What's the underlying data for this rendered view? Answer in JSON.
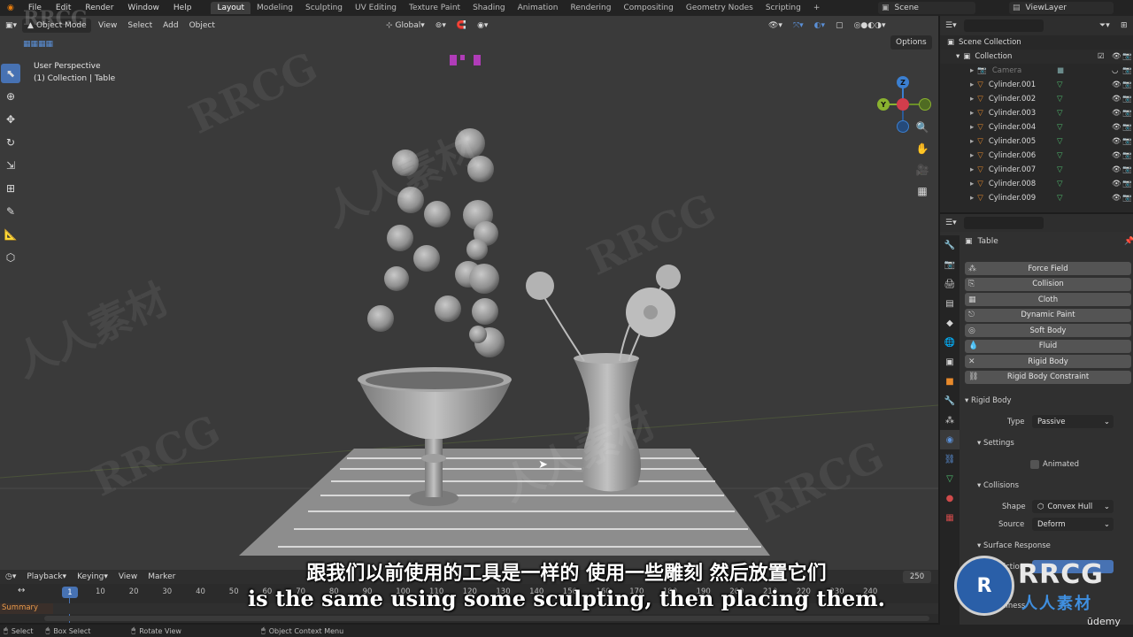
{
  "topbar": {
    "menus": [
      "File",
      "Edit",
      "Render",
      "Window",
      "Help"
    ],
    "workspaces": [
      "Layout",
      "Modeling",
      "Sculpting",
      "UV Editing",
      "Texture Paint",
      "Shading",
      "Animation",
      "Rendering",
      "Compositing",
      "Geometry Nodes",
      "Scripting"
    ],
    "active_workspace": "Layout",
    "add_workspace": "+",
    "scene": "Scene",
    "view_layer": "ViewLayer"
  },
  "viewport": {
    "mode": "Object Mode",
    "menus": [
      "View",
      "Select",
      "Add",
      "Object"
    ],
    "transform_orientation": "Global",
    "options": "Options",
    "info_line1": "User Perspective",
    "info_line2": "(1) Collection | Table",
    "gizmo": {
      "z": "Z",
      "y": "Y",
      "x": "X"
    }
  },
  "outliner": {
    "root": "Scene Collection",
    "collection": "Collection",
    "items": [
      "Camera",
      "Cylinder.001",
      "Cylinder.002",
      "Cylinder.003",
      "Cylinder.004",
      "Cylinder.005",
      "Cylinder.006",
      "Cylinder.007",
      "Cylinder.008",
      "Cylinder.009"
    ]
  },
  "properties": {
    "object_name": "Table",
    "physics_buttons": [
      "Force Field",
      "Collision",
      "Cloth",
      "Dynamic Paint",
      "Soft Body",
      "Fluid",
      "Rigid Body",
      "Rigid Body Constraint"
    ],
    "rigid_body_panel": "Rigid Body",
    "type_label": "Type",
    "type_value": "Passive",
    "settings_panel": "Settings",
    "animated_label": "Animated",
    "collisions_panel": "Collisions",
    "shape_label": "Shape",
    "shape_value": "Convex Hull",
    "source_label": "Source",
    "source_value": "Deform",
    "surface_panel": "Surface Response",
    "friction_partial": "Friction",
    "bounciness_partial": "Bounciness"
  },
  "timeline": {
    "menus": [
      "Playback",
      "Keying",
      "View",
      "Marker"
    ],
    "current_frame": "1",
    "ticks": [
      "10",
      "20",
      "30",
      "40",
      "50",
      "60",
      "70",
      "80",
      "90",
      "100",
      "110",
      "120",
      "130",
      "140",
      "150",
      "160",
      "170",
      "180",
      "190",
      "200",
      "210",
      "220",
      "230",
      "240"
    ],
    "end_frame": "250",
    "summary": "Summary"
  },
  "statusbar": {
    "select": "Select",
    "box_select": "Box Select",
    "rotate_view": "Rotate View",
    "context_menu": "Object Context Menu"
  },
  "subtitles": {
    "chinese": "跟我们以前使用的工具是一样的 使用一些雕刻 然后放置它们",
    "english": "is the same using some sculpting, then placing them."
  },
  "watermark": {
    "brand": "RRCG",
    "brand_cn": "人人素材",
    "udemy": "ūdemy"
  },
  "colors": {
    "accent": "#4772b3",
    "viewport_bg": "#3a3a3a",
    "panel_bg": "#303030"
  }
}
